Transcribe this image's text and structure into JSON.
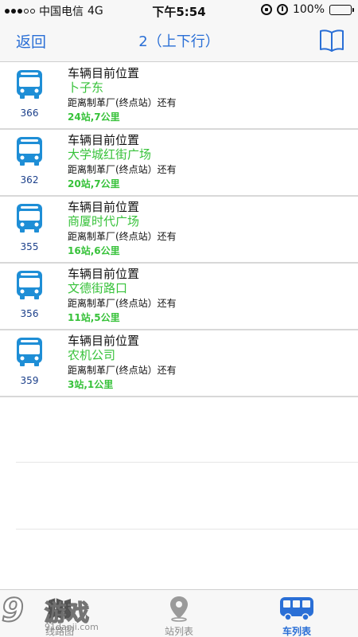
{
  "status_bar": {
    "carrier": "中国电信",
    "network": "4G",
    "time": "下午5:54",
    "battery": "100%"
  },
  "nav": {
    "back_label": "返回",
    "title": "2（上下行）",
    "right_icon": "book-icon"
  },
  "vehicles": [
    {
      "bus_no": "366",
      "heading": "车辆目前位置",
      "location": "卜子东",
      "distance_label": "距离制革厂(终点站）还有",
      "remaining": "24站,7公里"
    },
    {
      "bus_no": "362",
      "heading": "车辆目前位置",
      "location": "大学城红街广场",
      "distance_label": "距离制革厂(终点站）还有",
      "remaining": "20站,7公里"
    },
    {
      "bus_no": "355",
      "heading": "车辆目前位置",
      "location": "商厦时代广场",
      "distance_label": "距离制革厂(终点站）还有",
      "remaining": "16站,6公里"
    },
    {
      "bus_no": "356",
      "heading": "车辆目前位置",
      "location": "文德街路口",
      "distance_label": "距离制革厂(终点站）还有",
      "remaining": "11站,5公里"
    },
    {
      "bus_no": "359",
      "heading": "车辆目前位置",
      "location": "农机公司",
      "distance_label": "距离制革厂(终点站）还有",
      "remaining": "3站,1公里"
    }
  ],
  "tabs": [
    {
      "label": "线路图",
      "icon": "route-map-icon",
      "active": false
    },
    {
      "label": "站列表",
      "icon": "location-pin-icon",
      "active": false
    },
    {
      "label": "车列表",
      "icon": "bus-icon",
      "active": true
    }
  ],
  "watermark": {
    "number": "9",
    "text": "游戏",
    "url": "91danji.com"
  },
  "colors": {
    "accent": "#2a6fd6",
    "bus_icon": "#1e8ed6",
    "green": "#37c23a"
  }
}
